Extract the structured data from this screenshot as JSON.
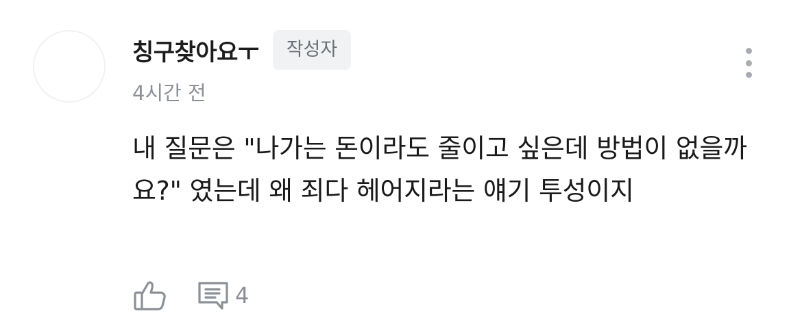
{
  "comment": {
    "author": "칭구찾아요ㅜ",
    "badge": "작성자",
    "time": "4시간 전",
    "text": "내 질문은 \"나가는 돈이라도 줄이고 싶은데 방법이 없을까요?\" 였는데 왜 죄다 헤어지라는 얘기 투성이지",
    "reply_count": "4",
    "icons": {
      "avatar": "avatar-placeholder",
      "more": "more-vertical-icon",
      "like": "thumbs-up-icon",
      "reply": "comment-icon"
    },
    "colors": {
      "text": "#1a1a1a",
      "muted": "#8c9096",
      "badge_bg": "#f1f2f4",
      "icon": "#a8acb2"
    }
  }
}
